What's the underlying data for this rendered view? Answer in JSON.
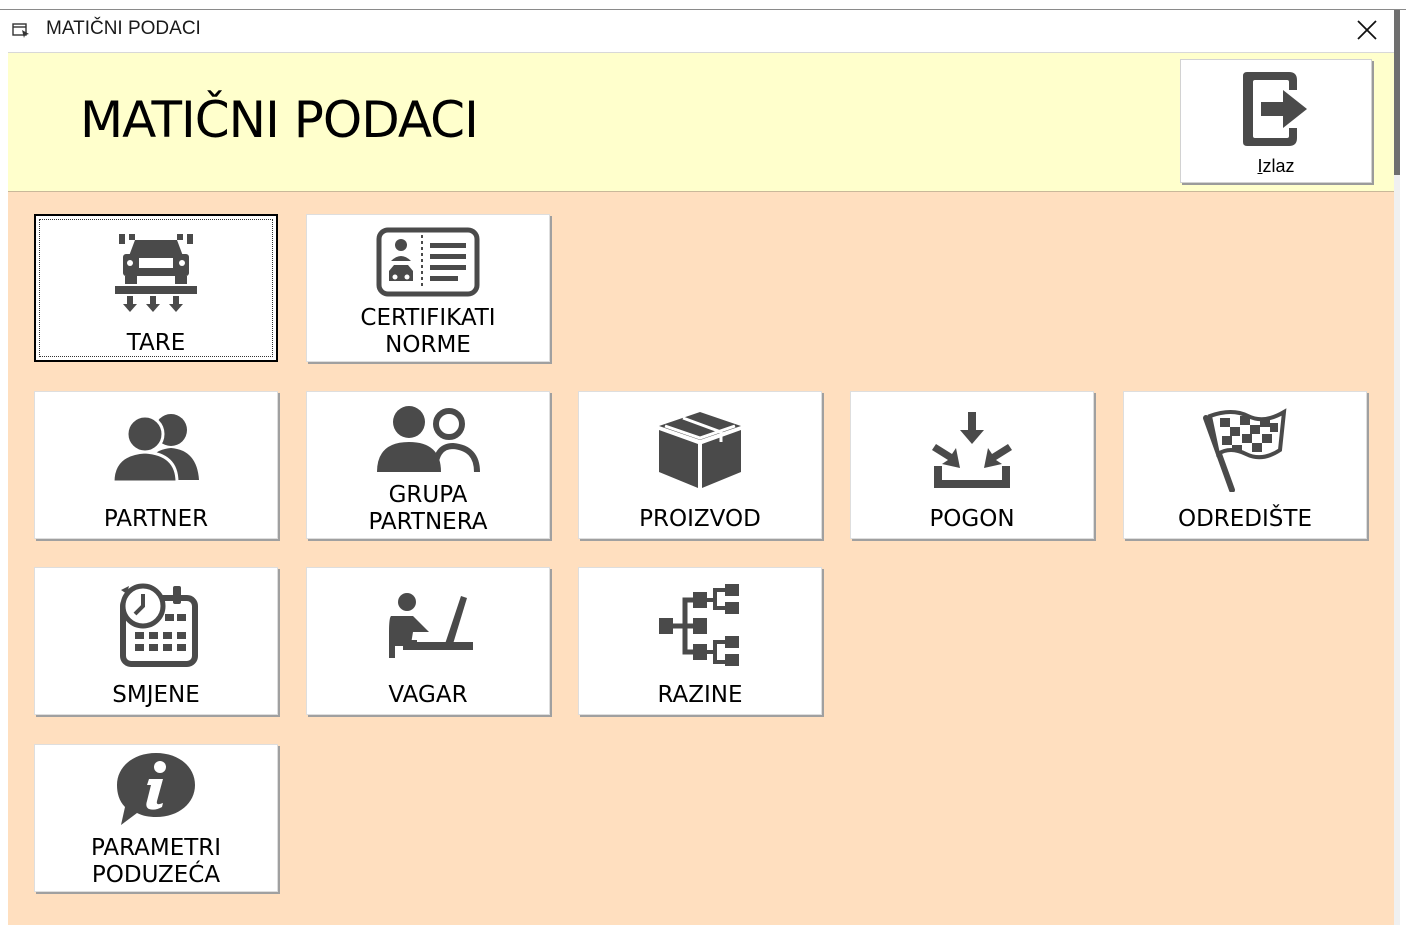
{
  "window": {
    "title": "MATIČNI PODACI",
    "app_icon": "form-icon",
    "close_icon": "close-icon"
  },
  "header": {
    "title": "MATIČNI PODACI",
    "background": "#ffffcc",
    "exit_button": {
      "label_prefix": "I",
      "label_rest": "zlaz",
      "icon": "exit-door-icon"
    }
  },
  "content": {
    "background": "#ffdfbf",
    "tiles": [
      {
        "id": "tare",
        "label1": "TARE",
        "label2": "",
        "icon": "truck-scale-icon",
        "focused": true
      },
      {
        "id": "certifikati",
        "label1": "CERTIFIKATI",
        "label2": "NORME",
        "icon": "certificate-card-icon",
        "focused": false
      },
      {
        "id": "partner",
        "label1": "PARTNER",
        "label2": "",
        "icon": "users-icon",
        "focused": false
      },
      {
        "id": "grupa",
        "label1": "GRUPA",
        "label2": "PARTNERA",
        "icon": "user-group-icon",
        "focused": false
      },
      {
        "id": "proizvod",
        "label1": "PROIZVOD",
        "label2": "",
        "icon": "box-icon",
        "focused": false
      },
      {
        "id": "pogon",
        "label1": "POGON",
        "label2": "",
        "icon": "inbox-arrows-icon",
        "focused": false
      },
      {
        "id": "odrediste",
        "label1": "ODREDIŠTE",
        "label2": "",
        "icon": "checkered-flag-icon",
        "focused": false
      },
      {
        "id": "smjene",
        "label1": "SMJENE",
        "label2": "",
        "icon": "calendar-clock-icon",
        "focused": false
      },
      {
        "id": "vagar",
        "label1": "VAGAR",
        "label2": "",
        "icon": "operator-desk-icon",
        "focused": false
      },
      {
        "id": "razine",
        "label1": "RAZINE",
        "label2": "",
        "icon": "hierarchy-icon",
        "focused": false
      },
      {
        "id": "parametri",
        "label1": "PARAMETRI",
        "label2": "PODUZEĆA",
        "icon": "info-bubble-icon",
        "focused": false
      }
    ]
  },
  "colors": {
    "icon": "#4a4a4a",
    "tile_bg": "#ffffff"
  }
}
